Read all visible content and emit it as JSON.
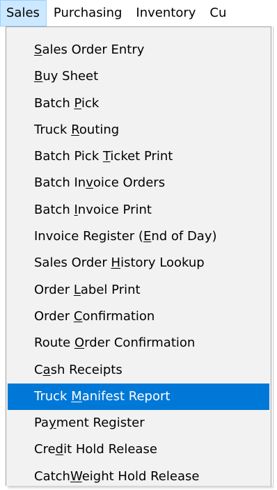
{
  "menubar": {
    "items": [
      {
        "label": "Sales",
        "active": true
      },
      {
        "label": "Purchasing"
      },
      {
        "label": "Inventory"
      },
      {
        "label": "Cu"
      }
    ]
  },
  "sales_menu": {
    "highlight_color": "#0078d7",
    "items": [
      {
        "pre": "",
        "key": "S",
        "post": "ales Order Entry"
      },
      {
        "pre": "",
        "key": "B",
        "post": "uy Sheet"
      },
      {
        "pre": "Batch ",
        "key": "P",
        "post": "ick"
      },
      {
        "pre": "Truck ",
        "key": "R",
        "post": "outing"
      },
      {
        "pre": "Batch Pick ",
        "key": "T",
        "post": "icket Print"
      },
      {
        "pre": "Batch In",
        "key": "v",
        "post": "oice Orders"
      },
      {
        "pre": "Batch ",
        "key": "I",
        "post": "nvoice Print"
      },
      {
        "pre": "Invoice Register (",
        "key": "E",
        "post": "nd of Day)"
      },
      {
        "pre": "Sales Order ",
        "key": "H",
        "post": "istory Lookup"
      },
      {
        "pre": "Order ",
        "key": "L",
        "post": "abel Print"
      },
      {
        "pre": "Order ",
        "key": "C",
        "post": "onfirmation"
      },
      {
        "pre": "Route ",
        "key": "O",
        "post": "rder Confirmation"
      },
      {
        "pre": "C",
        "key": "a",
        "post": "sh Receipts"
      },
      {
        "pre": "Truck ",
        "key": "M",
        "post": "anifest Report",
        "highlighted": true
      },
      {
        "pre": "Pa",
        "key": "y",
        "post": "ment Register"
      },
      {
        "pre": "Cre",
        "key": "d",
        "post": "it Hold Release"
      },
      {
        "pre": "Catch",
        "key": "W",
        "post": "eight Hold Release"
      }
    ]
  }
}
